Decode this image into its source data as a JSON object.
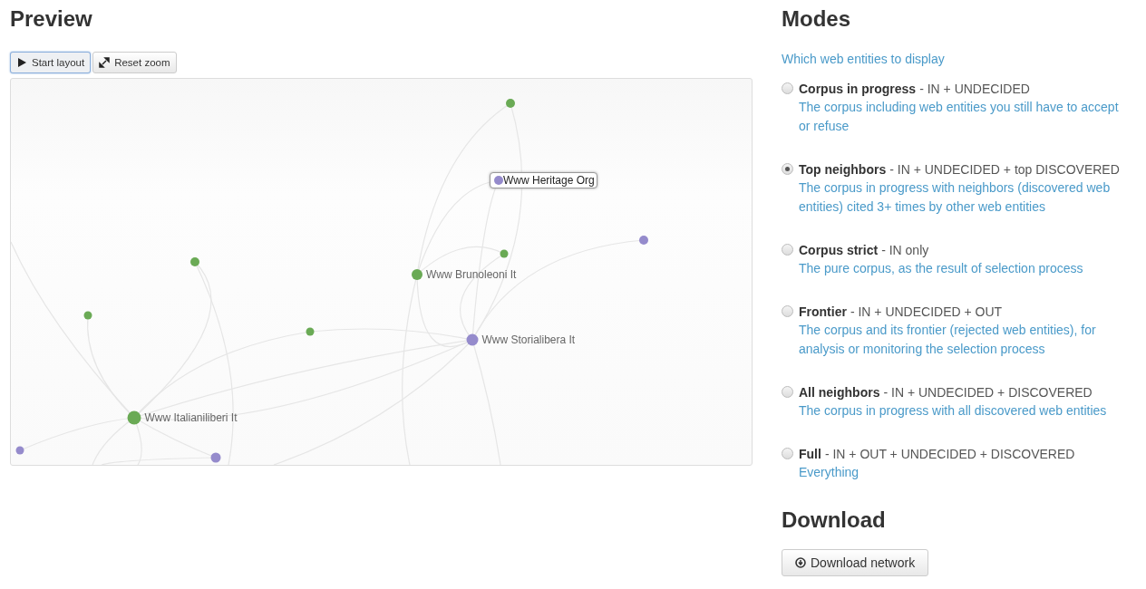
{
  "preview": {
    "title": "Preview",
    "buttons": [
      {
        "kind": "play",
        "label": "Start layout",
        "selected": true
      },
      {
        "kind": "zoom",
        "label": "Reset zoom",
        "selected": false
      }
    ],
    "nodes": [
      {
        "color": "#6aaa55"
      },
      {
        "label": "Www Heritage Org",
        "color": "#958bcc",
        "highlighted": true
      },
      {
        "color": "#6aaa55"
      },
      {
        "color": "#958bcc"
      },
      {
        "label": "Www Brunoleoni It",
        "color": "#6aaa55",
        "highlighted": false
      },
      {
        "color": "#6aaa55"
      },
      {
        "color": "#6aaa55"
      },
      {
        "color": "#6aaa55"
      },
      {
        "label": "Www Storialibera It",
        "color": "#958bcc",
        "highlighted": false
      },
      {
        "label": "Www Italianiliberi It",
        "color": "#6aaa55",
        "highlighted": false
      },
      {
        "color": "#958bcc"
      },
      {
        "color": "#958bcc"
      }
    ]
  },
  "modes": {
    "title": "Modes",
    "subtitle": "Which web entities to display",
    "options": [
      {
        "name": "Corpus in progress",
        "formula": "- IN + UNDECIDED",
        "description": "The corpus including web entities you still have to accept or refuse",
        "selected": false
      },
      {
        "name": "Top neighbors",
        "formula": "- IN + UNDECIDED + top DISCOVERED",
        "description": "The corpus in progress with neighbors (discovered web entities) cited 3+ times by other web entities",
        "selected": true
      },
      {
        "name": "Corpus strict",
        "formula": "- IN only",
        "description": "The pure corpus, as the result of selection process",
        "selected": false
      },
      {
        "name": "Frontier",
        "formula": "- IN + UNDECIDED + OUT",
        "description": "The corpus and its frontier (rejected web entities), for analysis or monitoring the selection process",
        "selected": false
      },
      {
        "name": "All neighbors",
        "formula": "- IN + UNDECIDED + DISCOVERED",
        "description": "The corpus in progress with all discovered web entities",
        "selected": false
      },
      {
        "name": "Full",
        "formula": "- IN + OUT + UNDECIDED + DISCOVERED",
        "description": "Everything",
        "selected": false
      }
    ]
  },
  "download": {
    "title": "Download",
    "button": "Download network"
  }
}
